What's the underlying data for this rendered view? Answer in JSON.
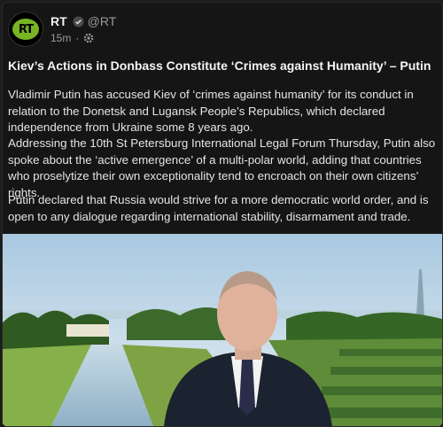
{
  "post": {
    "author": {
      "display_name": "RT",
      "handle": "@RT",
      "avatar_text": "RT"
    },
    "meta": {
      "time": "15m",
      "separator": "·"
    },
    "title": "Kiev’s Actions in Donbass Constitute ‘Crimes against Humanity’ – Putin",
    "paragraphs": [
      "Vladimir Putin has accused Kiev of ‘crimes against humanity’ for its conduct in relation to the Donetsk and Lugansk People’s Republics, which declared independence from Ukraine some 8 years ago.",
      "Addressing the 10th St Petersburg International Legal Forum Thursday, Putin also spoke about the ‘active emergence’ of a multi-polar world, adding that countries who proselytize their own exceptionality tend to encroach on their own citizens’ rights.",
      "Putin declared that Russia would strive for a more democratic world order, and is open to any dialogue regarding international stability, disarmament and trade."
    ]
  },
  "colors": {
    "background": "#151515",
    "text": "#e4e4e4",
    "muted": "#9a9a9a",
    "avatar_green": "#78b424"
  },
  "icons": {
    "verified": "verified-badge-icon",
    "audience": "gear-icon"
  }
}
